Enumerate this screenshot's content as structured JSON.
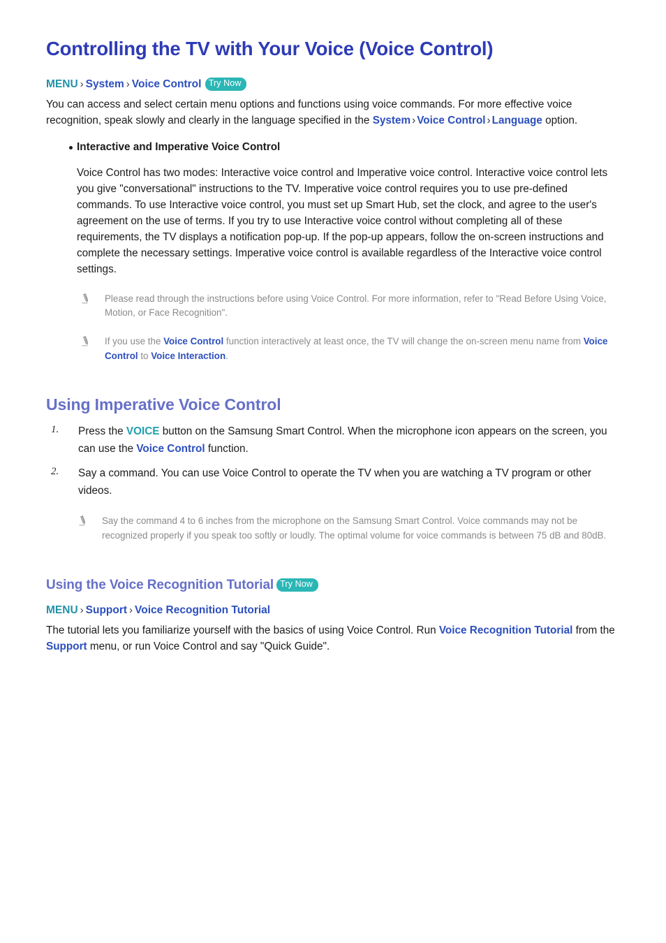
{
  "colors": {
    "title_blue": "#2d3bb5",
    "section_blue": "#6670c8",
    "link_blue": "#2c4fbe",
    "menu_teal": "#2391a8",
    "badge_teal": "#2bb6b6",
    "note_gray": "#8a8a8a",
    "body_black": "#1b1b1b"
  },
  "title": "Controlling the TV with Your Voice (Voice Control)",
  "breadcrumb_1": {
    "menu": "MENU",
    "sep": "›",
    "item1": "System",
    "item2": "Voice Control",
    "badge": "Try Now"
  },
  "intro": {
    "part1": "You can access and select certain menu options and functions using voice commands. For more effective voice recognition, speak slowly and clearly in the language specified in the ",
    "link1": "System",
    "sep1": "›",
    "link2": "Voice Control",
    "sep2": "›",
    "link3": "Language",
    "part2": " option."
  },
  "bullet": {
    "title": "Interactive and Imperative Voice Control",
    "body": "Voice Control has two modes: Interactive voice control and Imperative voice control. Interactive voice control lets you give \"conversational\" instructions to the TV. Imperative voice control requires you to use pre-defined commands. To use Interactive voice control, you must set up Smart Hub, set the clock, and agree to the user's agreement on the use of terms. If you try to use Interactive voice control without completing all of these requirements, the TV displays a notification pop-up. If the pop-up appears, follow the on-screen instructions and complete the necessary settings. Imperative voice control is available regardless of the Interactive voice control settings."
  },
  "notes_top": [
    {
      "icon": "pencil-icon",
      "text": "Please read through the instructions before using Voice Control. For more information, refer to \"Read Before Using Voice, Motion, or Face Recognition\"."
    }
  ],
  "note_voice_interaction": {
    "icon": "pencil-icon",
    "part1": "If you use the ",
    "link1": "Voice Control",
    "part2": " function interactively at least once, the TV will change the on-screen menu name from ",
    "link2": "Voice Control",
    "part3": " to ",
    "link3": "Voice Interaction",
    "part4": "."
  },
  "section_imperative": {
    "heading": "Using Imperative Voice Control",
    "steps": [
      {
        "num": "1.",
        "part1": "Press the ",
        "link1": "VOICE",
        "part2": " button on the Samsung Smart Control. When the microphone icon appears on the screen, you can use the ",
        "link2": "Voice Control",
        "part3": " function."
      },
      {
        "num": "2.",
        "part1": "Say a command. You can use Voice Control to operate the TV when you are watching a TV program or other videos.",
        "link1": "",
        "part2": "",
        "link2": "",
        "part3": ""
      }
    ],
    "note": {
      "icon": "pencil-icon",
      "text": "Say the command 4 to 6 inches from the microphone on the Samsung Smart Control. Voice commands may not be recognized properly if you speak too softly or loudly. The optimal volume for voice commands is between 75 dB and 80dB."
    }
  },
  "section_tutorial": {
    "heading": "Using the Voice Recognition Tutorial",
    "badge": "Try Now",
    "breadcrumb": {
      "menu": "MENU",
      "sep": "›",
      "item1": "Support",
      "item2": "Voice Recognition Tutorial"
    },
    "body": {
      "part1": "The tutorial lets you familiarize yourself with the basics of using Voice Control. Run ",
      "link1": "Voice Recognition Tutorial",
      "part2": " from the ",
      "link2": "Support",
      "part3": " menu, or run Voice Control and say \"Quick Guide\"."
    }
  }
}
